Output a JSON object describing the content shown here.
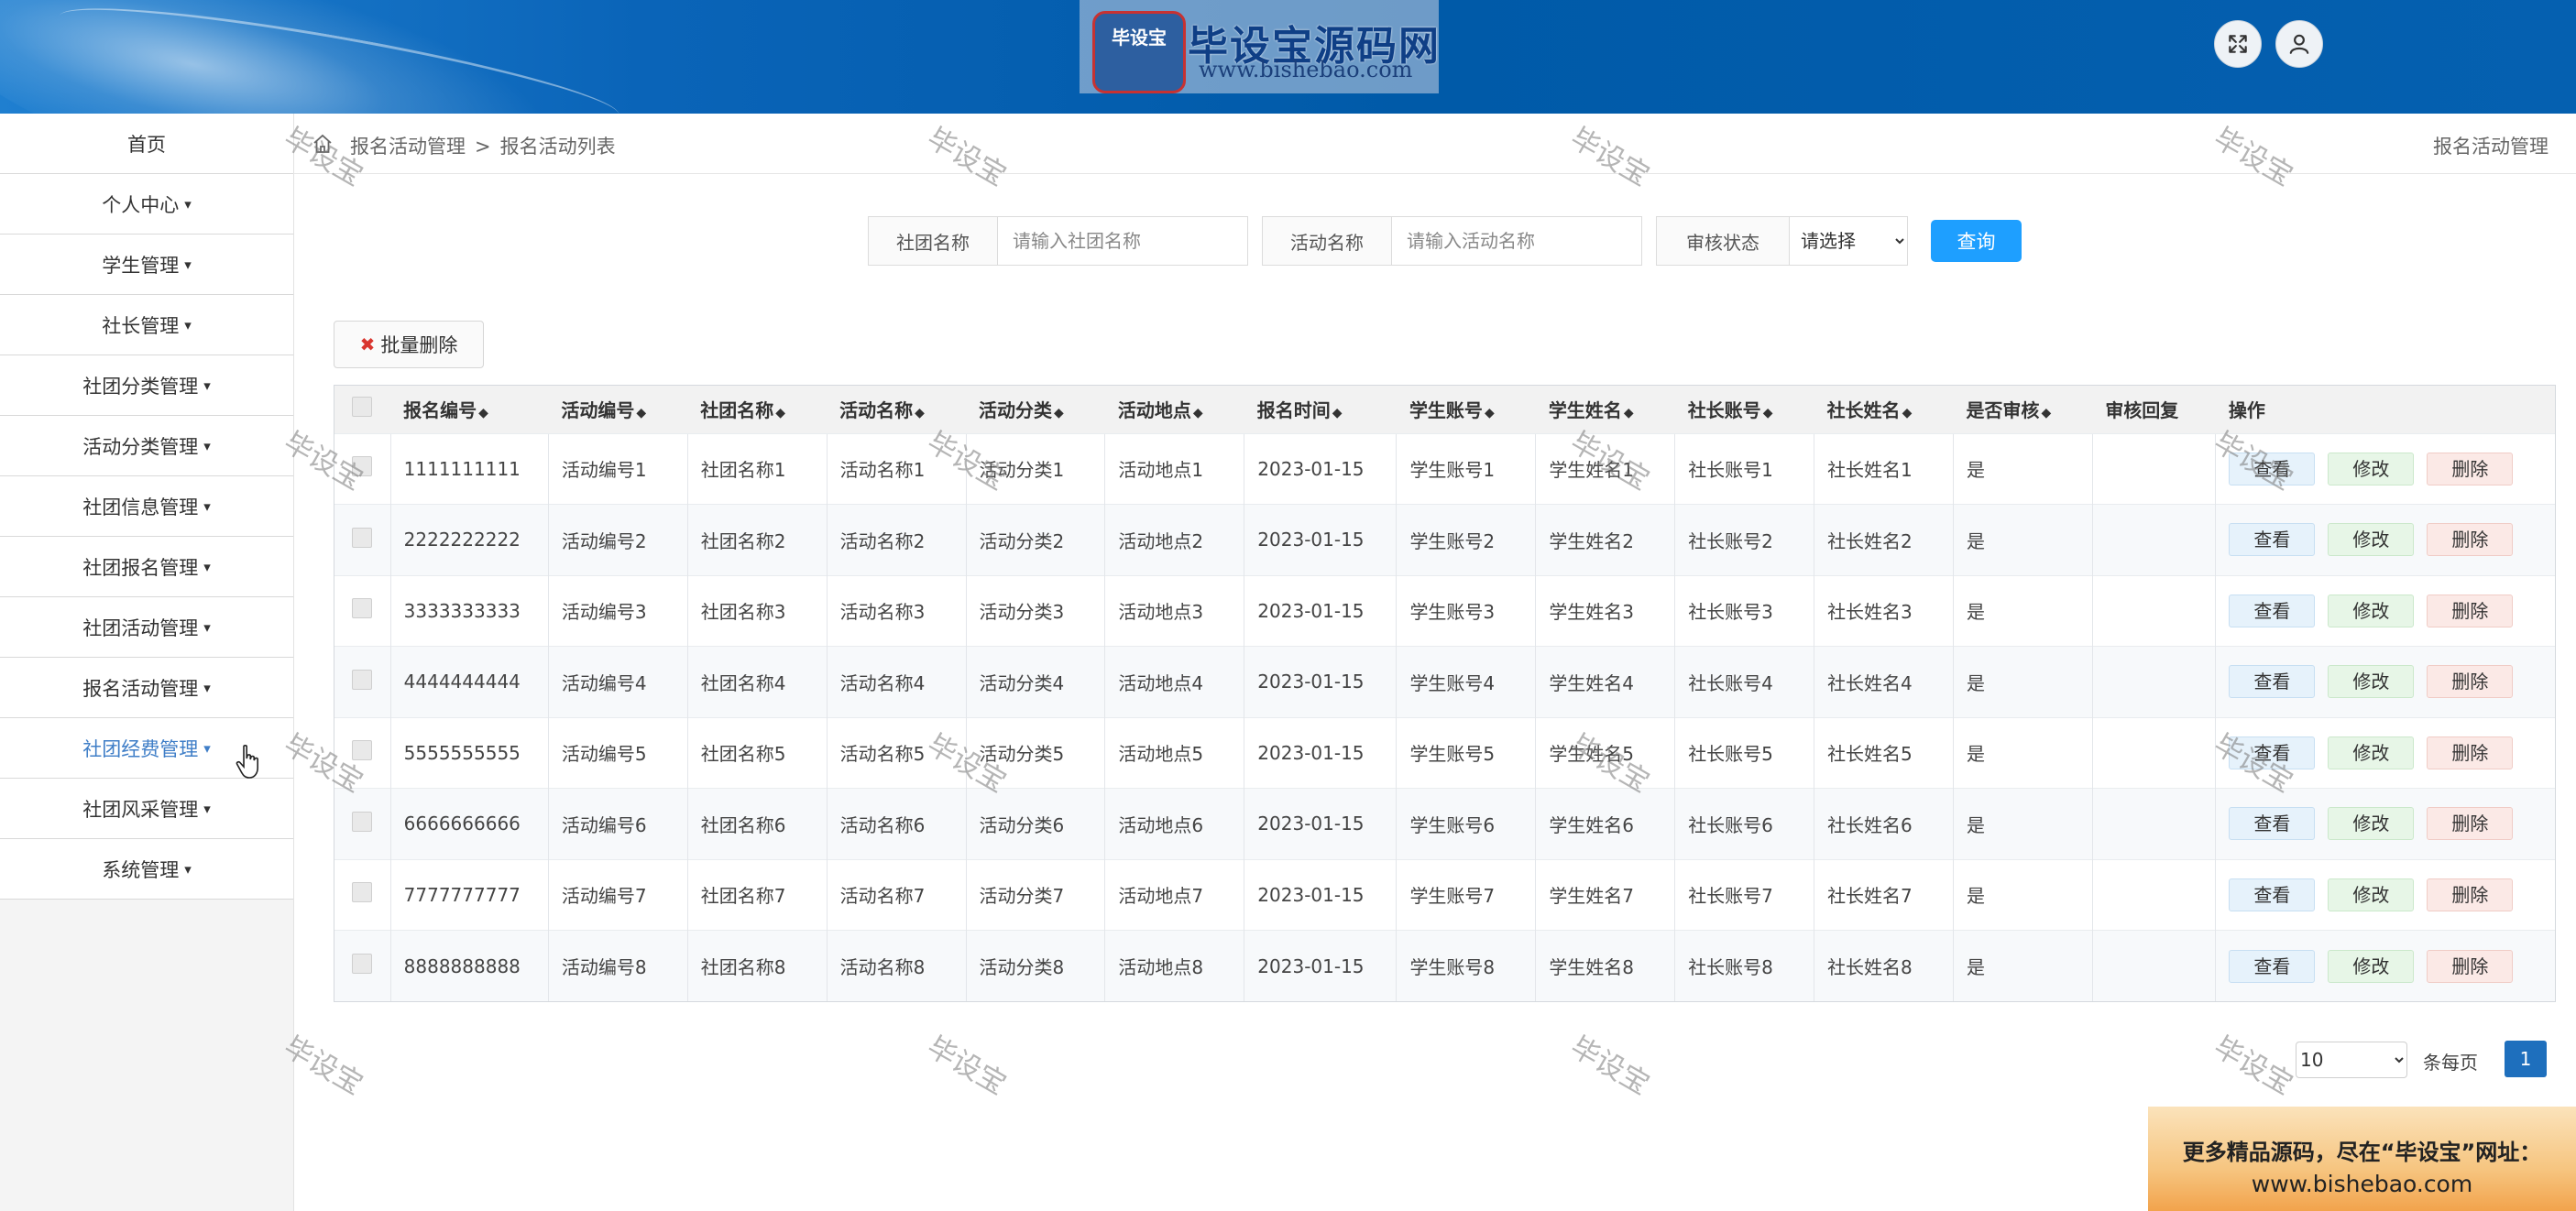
{
  "header": {
    "logo_badge": "毕设宝",
    "logo_title": "毕设宝源码网",
    "logo_url": "www.bishebao.com",
    "fullscreen_icon": "expand-icon",
    "user_icon": "user-icon"
  },
  "sidebar": {
    "items": [
      {
        "label": "首页",
        "caret": ""
      },
      {
        "label": "个人中心",
        "caret": "▾"
      },
      {
        "label": "学生管理",
        "caret": "▾"
      },
      {
        "label": "社长管理",
        "caret": "▾"
      },
      {
        "label": "社团分类管理",
        "caret": "▾"
      },
      {
        "label": "活动分类管理",
        "caret": "▾"
      },
      {
        "label": "社团信息管理",
        "caret": "▾"
      },
      {
        "label": "社团报名管理",
        "caret": "▾"
      },
      {
        "label": "社团活动管理",
        "caret": "▾"
      },
      {
        "label": "报名活动管理",
        "caret": "▾"
      },
      {
        "label": "社团经费管理",
        "caret": "▾"
      },
      {
        "label": "社团风采管理",
        "caret": "▾"
      },
      {
        "label": "系统管理",
        "caret": "▾"
      }
    ]
  },
  "breadcrumb": {
    "parent": "报名活动管理",
    "separator": ">",
    "current": "报名活动列表",
    "right_title": "报名活动管理"
  },
  "search": {
    "club_label": "社团名称",
    "club_placeholder": "请输入社团名称",
    "activity_label": "活动名称",
    "activity_placeholder": "请输入活动名称",
    "status_label": "审核状态",
    "status_selected": "请选择",
    "query_label": "查询"
  },
  "toolbar": {
    "batch_delete_icon": "✖",
    "batch_delete_label": "批量删除"
  },
  "table": {
    "sort_glyph": "◆",
    "headers": [
      "报名编号",
      "活动编号",
      "社团名称",
      "活动名称",
      "活动分类",
      "活动地点",
      "报名时间",
      "学生账号",
      "学生姓名",
      "社长账号",
      "社长姓名",
      "是否审核",
      "审核回复",
      "操作"
    ],
    "sortable": [
      true,
      true,
      true,
      true,
      true,
      true,
      true,
      true,
      true,
      true,
      true,
      true,
      false,
      false
    ],
    "rows": [
      [
        "1111111111",
        "活动编号1",
        "社团名称1",
        "活动名称1",
        "活动分类1",
        "活动地点1",
        "2023-01-15",
        "学生账号1",
        "学生姓名1",
        "社长账号1",
        "社长姓名1",
        "是",
        ""
      ],
      [
        "2222222222",
        "活动编号2",
        "社团名称2",
        "活动名称2",
        "活动分类2",
        "活动地点2",
        "2023-01-15",
        "学生账号2",
        "学生姓名2",
        "社长账号2",
        "社长姓名2",
        "是",
        ""
      ],
      [
        "3333333333",
        "活动编号3",
        "社团名称3",
        "活动名称3",
        "活动分类3",
        "活动地点3",
        "2023-01-15",
        "学生账号3",
        "学生姓名3",
        "社长账号3",
        "社长姓名3",
        "是",
        ""
      ],
      [
        "4444444444",
        "活动编号4",
        "社团名称4",
        "活动名称4",
        "活动分类4",
        "活动地点4",
        "2023-01-15",
        "学生账号4",
        "学生姓名4",
        "社长账号4",
        "社长姓名4",
        "是",
        ""
      ],
      [
        "5555555555",
        "活动编号5",
        "社团名称5",
        "活动名称5",
        "活动分类5",
        "活动地点5",
        "2023-01-15",
        "学生账号5",
        "学生姓名5",
        "社长账号5",
        "社长姓名5",
        "是",
        ""
      ],
      [
        "6666666666",
        "活动编号6",
        "社团名称6",
        "活动名称6",
        "活动分类6",
        "活动地点6",
        "2023-01-15",
        "学生账号6",
        "学生姓名6",
        "社长账号6",
        "社长姓名6",
        "是",
        ""
      ],
      [
        "7777777777",
        "活动编号7",
        "社团名称7",
        "活动名称7",
        "活动分类7",
        "活动地点7",
        "2023-01-15",
        "学生账号7",
        "学生姓名7",
        "社长账号7",
        "社长姓名7",
        "是",
        ""
      ],
      [
        "8888888888",
        "活动编号8",
        "社团名称8",
        "活动名称8",
        "活动分类8",
        "活动地点8",
        "2023-01-15",
        "学生账号8",
        "学生姓名8",
        "社长账号8",
        "社长姓名8",
        "是",
        ""
      ]
    ],
    "actions": {
      "view": "查看",
      "edit": "修改",
      "delete": "删除"
    }
  },
  "pagination": {
    "page_size": "10",
    "page_size_options": [
      "10"
    ],
    "per_page_label": "条每页",
    "current_page": "1"
  },
  "ad": {
    "line1": "更多精品源码，尽在“毕设宝”网址：",
    "line2": "www.bishebao.com"
  },
  "watermark": "毕设宝",
  "colors": {
    "header_blue": "#005aa8",
    "primary_button": "#1e9fff",
    "active_page": "#1e6fbd",
    "delete_x": "#d9362f"
  }
}
